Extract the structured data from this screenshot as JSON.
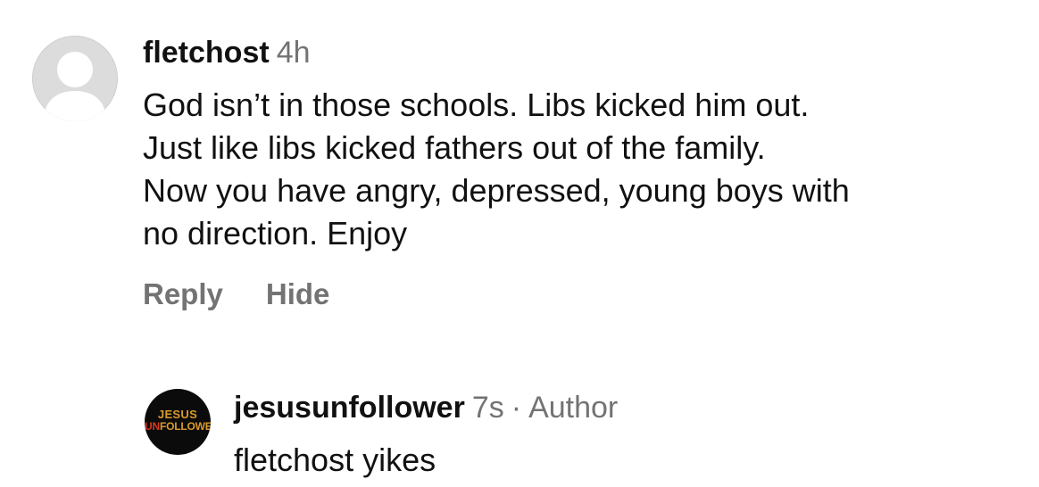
{
  "comment": {
    "username": "fletchost",
    "time": "4h",
    "lines": [
      "God isn’t in those schools.  Libs kicked him out.",
      "Just like libs kicked fathers out of the family.",
      "Now you have angry, depressed, young boys with",
      "no direction.  Enjoy"
    ],
    "reply_label": "Reply",
    "hide_label": "Hide"
  },
  "reply": {
    "username": "jesusunfollower",
    "time": "7s",
    "separator": "·",
    "author_label": "Author",
    "text": "fletchost yikes",
    "logo": {
      "line1": "JESUS",
      "line2_prefix": "UN",
      "line2_rest": "FOLLOWER"
    }
  },
  "colors": {
    "text": "#111111",
    "secondary": "#737373",
    "default_avatar": "#dcdcdc",
    "logo_background": "#0b0b0b",
    "logo_gold": "#d99a2b",
    "logo_red": "#d33a22"
  }
}
